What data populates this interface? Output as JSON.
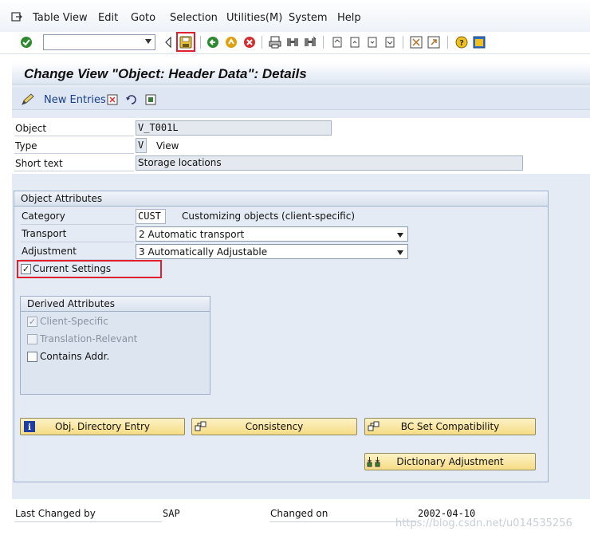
{
  "menubar": {
    "items": [
      "Table View",
      "Edit",
      "Goto",
      "Selection",
      "Utilities(M)",
      "System",
      "Help"
    ]
  },
  "icons": {
    "exit_menu": "exit-menu-icon",
    "enter": "green-check-icon",
    "save": "save-icon"
  },
  "window": {
    "title": "Change View \"Object: Header Data\": Details"
  },
  "app_toolbar": {
    "new_entries": "New Entries"
  },
  "header": {
    "object_label": "Object",
    "object_value": "V_T001L",
    "type_label": "Type",
    "type_value": "V",
    "type_text": "View",
    "short_text_label": "Short text",
    "short_text_value": "Storage locations"
  },
  "object_attributes": {
    "title": "Object Attributes",
    "category_label": "Category",
    "category_value": "CUST",
    "category_text": "Customizing objects (client-specific)",
    "transport_label": "Transport",
    "transport_value": "2 Automatic transport",
    "adjustment_label": "Adjustment",
    "adjustment_value": "3 Automatically Adjustable",
    "current_settings_label": "Current Settings",
    "current_settings_checked": true
  },
  "derived_attributes": {
    "title": "Derived Attributes",
    "client_specific": "Client-Specific",
    "translation_relevant": "Translation-Relevant",
    "contains_addr": "Contains Addr."
  },
  "buttons": {
    "obj_directory": "Obj. Directory Entry",
    "consistency": "Consistency",
    "bc_set": "BC Set Compatibility",
    "dictionary_adjustment": "Dictionary Adjustment"
  },
  "footer": {
    "last_changed_by_label": "Last Changed by",
    "last_changed_by_value": "SAP",
    "changed_on_label": "Changed on",
    "changed_on_value": "2002-04-10"
  },
  "watermark": "https://blog.csdn.net/u014535256",
  "colors": {
    "accent_red": "#e0202c",
    "button_yellow": "#f5dc84",
    "background": "#e4ebf4"
  }
}
